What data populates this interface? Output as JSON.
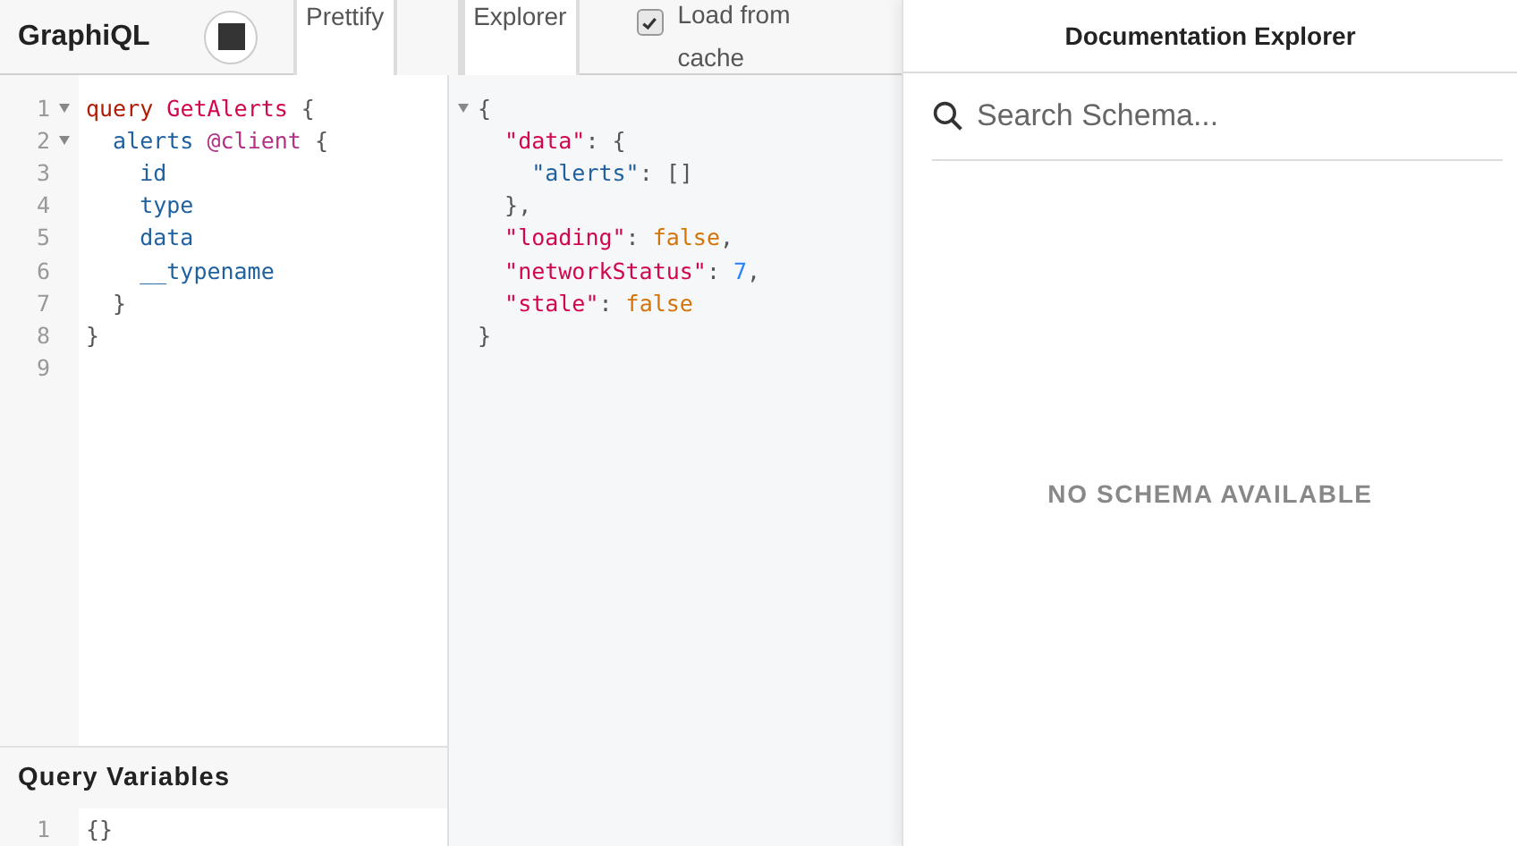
{
  "toolbar": {
    "title": "GraphiQL",
    "buttons": [
      {
        "kind": "text",
        "label": "Prettify"
      },
      {
        "kind": "blank"
      },
      {
        "kind": "text",
        "label": "Explorer"
      }
    ],
    "cache_checkbox": {
      "label": "Load from cache",
      "checked": true
    }
  },
  "query_editor": {
    "lines": [
      {
        "number": "1",
        "foldable": true,
        "tokens": [
          {
            "kind": "keyword",
            "text": "query"
          },
          {
            "kind": "def",
            "text": " GetAlerts"
          },
          {
            "kind": "punct",
            "text": " {"
          }
        ]
      },
      {
        "number": "2",
        "foldable": true,
        "tokens": [
          {
            "kind": "property",
            "text": "  alerts"
          },
          {
            "kind": "directive",
            "text": " @client"
          },
          {
            "kind": "punct",
            "text": " {"
          }
        ]
      },
      {
        "number": "3",
        "foldable": false,
        "tokens": [
          {
            "kind": "property",
            "text": "    id"
          }
        ]
      },
      {
        "number": "4",
        "foldable": false,
        "tokens": [
          {
            "kind": "property",
            "text": "    type"
          }
        ]
      },
      {
        "number": "5",
        "foldable": false,
        "tokens": [
          {
            "kind": "property",
            "text": "    data"
          }
        ]
      },
      {
        "number": "6",
        "foldable": false,
        "tokens": [
          {
            "kind": "property",
            "text": "    __typename"
          }
        ]
      },
      {
        "number": "7",
        "foldable": false,
        "tokens": [
          {
            "kind": "punct",
            "text": "  }"
          }
        ]
      },
      {
        "number": "8",
        "foldable": false,
        "tokens": [
          {
            "kind": "punct",
            "text": "}"
          }
        ]
      },
      {
        "number": "9",
        "foldable": false
      }
    ]
  },
  "variables": {
    "title": "Query Variables",
    "lines": [
      {
        "number": "1",
        "foldable": false,
        "tokens": [
          {
            "kind": "punct",
            "text": "{}"
          }
        ]
      }
    ]
  },
  "result": {
    "lines": [
      {
        "foldable": true,
        "tokens": [
          {
            "kind": "punct",
            "text": "{"
          }
        ]
      },
      {
        "foldable": false,
        "tokens": [
          {
            "kind": "key",
            "text": "  \"data\""
          },
          {
            "kind": "punct",
            "text": ": {"
          }
        ]
      },
      {
        "foldable": false,
        "tokens": [
          {
            "kind": "property",
            "text": "    \"alerts\""
          },
          {
            "kind": "punct",
            "text": ": []"
          }
        ]
      },
      {
        "foldable": false,
        "tokens": [
          {
            "kind": "punct",
            "text": "  },"
          }
        ]
      },
      {
        "foldable": false,
        "tokens": [
          {
            "kind": "key",
            "text": "  \"loading\""
          },
          {
            "kind": "punct",
            "text": ": "
          },
          {
            "kind": "bool",
            "text": "false"
          },
          {
            "kind": "punct",
            "text": ","
          }
        ]
      },
      {
        "foldable": false,
        "tokens": [
          {
            "kind": "key",
            "text": "  \"networkStatus\""
          },
          {
            "kind": "punct",
            "text": ": "
          },
          {
            "kind": "number",
            "text": "7"
          },
          {
            "kind": "punct",
            "text": ","
          }
        ]
      },
      {
        "foldable": false,
        "tokens": [
          {
            "kind": "key",
            "text": "  \"stale\""
          },
          {
            "kind": "punct",
            "text": ": "
          },
          {
            "kind": "bool",
            "text": "false"
          }
        ]
      },
      {
        "foldable": false,
        "tokens": [
          {
            "kind": "punct",
            "text": "}"
          }
        ]
      }
    ]
  },
  "docs": {
    "title": "Documentation Explorer",
    "search": {
      "placeholder": "Search Schema..."
    },
    "empty_message": "NO SCHEMA AVAILABLE"
  }
}
